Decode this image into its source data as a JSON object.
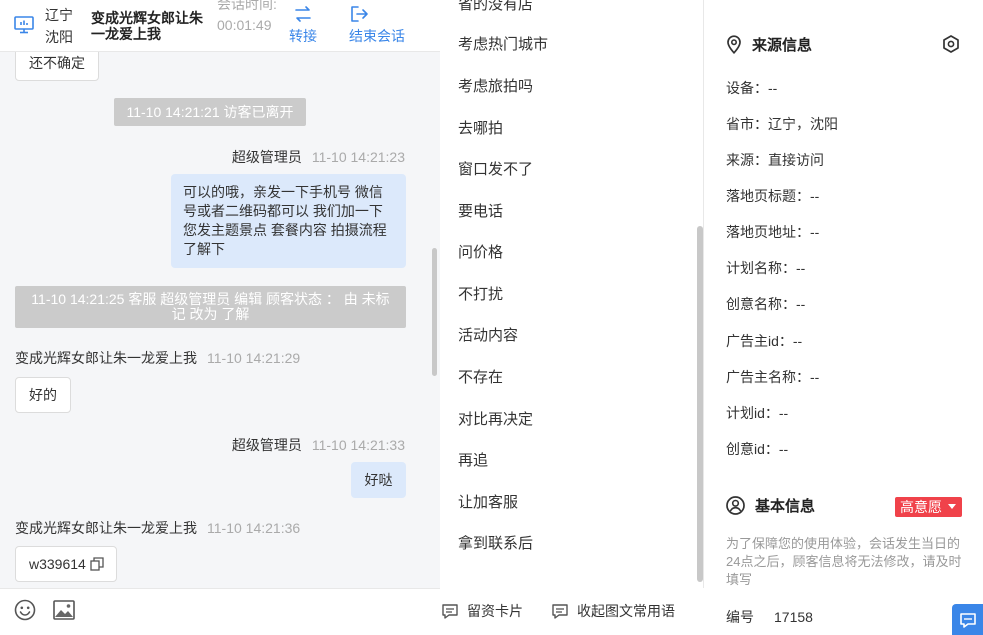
{
  "header": {
    "location_province": "辽宁",
    "location_city": "沈阳",
    "visitor_name": "变成光辉女郎让朱一龙爱上我",
    "session_time_label": "会话时间:",
    "session_time": "00:01:49",
    "transfer_label": "转接",
    "end_label": "结束会话"
  },
  "messages": {
    "m1_text": "还不确定",
    "sys1": "11-10 14:21:21 访客已离开",
    "m2_sender": "超级管理员",
    "m2_time": "11-10 14:21:23",
    "m2_text": "可以的哦，亲发一下手机号 微信号或者二维码都可以 我们加一下您发主题景点 套餐内容 拍摄流程了解下",
    "sys2": "11-10 14:21:25 客服 超级管理员 编辑 顾客状态 ： 由 未标记 改为 了解",
    "m3_sender": "变成光辉女郎让朱一龙爱上我",
    "m3_time": "11-10 14:21:29",
    "m3_text": "好的",
    "m4_sender": "超级管理员",
    "m4_time": "11-10 14:21:33",
    "m4_text": "好哒",
    "m5_sender": "变成光辉女郎让朱一龙爱上我",
    "m5_time": "11-10 14:21:36",
    "m5_text": "w339614"
  },
  "phrases": [
    "省的没有店",
    "考虑热门城市",
    "考虑旅拍吗",
    "去哪拍",
    "窗口发不了",
    "要电话",
    "问价格",
    "不打扰",
    "活动内容",
    "不存在",
    "对比再决定",
    "再追",
    "让加客服",
    "拿到联系后"
  ],
  "toolbar": {
    "card_label": "留资卡片",
    "collapse_label": "收起图文常用语"
  },
  "source": {
    "title": "来源信息",
    "rows": [
      "设备：--",
      "省市：辽宁，沈阳",
      "来源：直接访问",
      "落地页标题：--",
      "落地页地址：--",
      "计划名称：--",
      "创意名称：--",
      "广告主id：--",
      "广告主名称：--",
      "计划id：--",
      "创意id：--"
    ]
  },
  "basic": {
    "title": "基本信息",
    "intent_badge": "高意愿",
    "note": "为了保障您的使用体验，会话发生当日的24点之后，顾客信息将无法修改，请及时填写",
    "id_label": "编号",
    "id_value": "17158"
  },
  "colors": {
    "accent": "#3a86e8",
    "badge": "#f0424a",
    "bubble_out": "#dce9fb",
    "system_msg": "#cbcbcb"
  }
}
